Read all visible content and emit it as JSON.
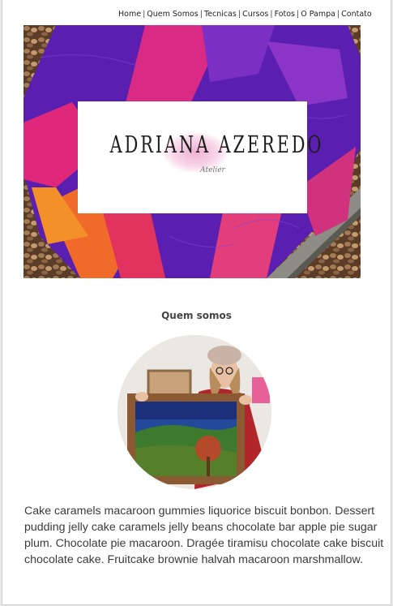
{
  "nav": {
    "items": [
      "Home",
      "Quem Somos",
      "Tecnicas",
      "Cursos",
      "Fotos",
      "O Pampa",
      "Contato"
    ],
    "separator": "|"
  },
  "hero": {
    "logo_title": "ADRIANA AZEREDO",
    "logo_subtitle": "Atelier"
  },
  "about": {
    "title": "Quem somos",
    "paragraph": "Cake caramels macaroon gummies liquorice biscuit bonbon. Dessert pudding jelly cake caramels jelly beans chocolate bar apple pie sugar plum. Chocolate pie macaroon. Dragée tiramisu chocolate cake biscuit chocolate cake. Fruitcake brownie halvah macaroon marshmallow."
  },
  "colors": {
    "quilt_purple": "#5a1fb0",
    "quilt_pink": "#e0287a",
    "quilt_orange": "#f06a2a",
    "text": "#3a3a3a"
  }
}
